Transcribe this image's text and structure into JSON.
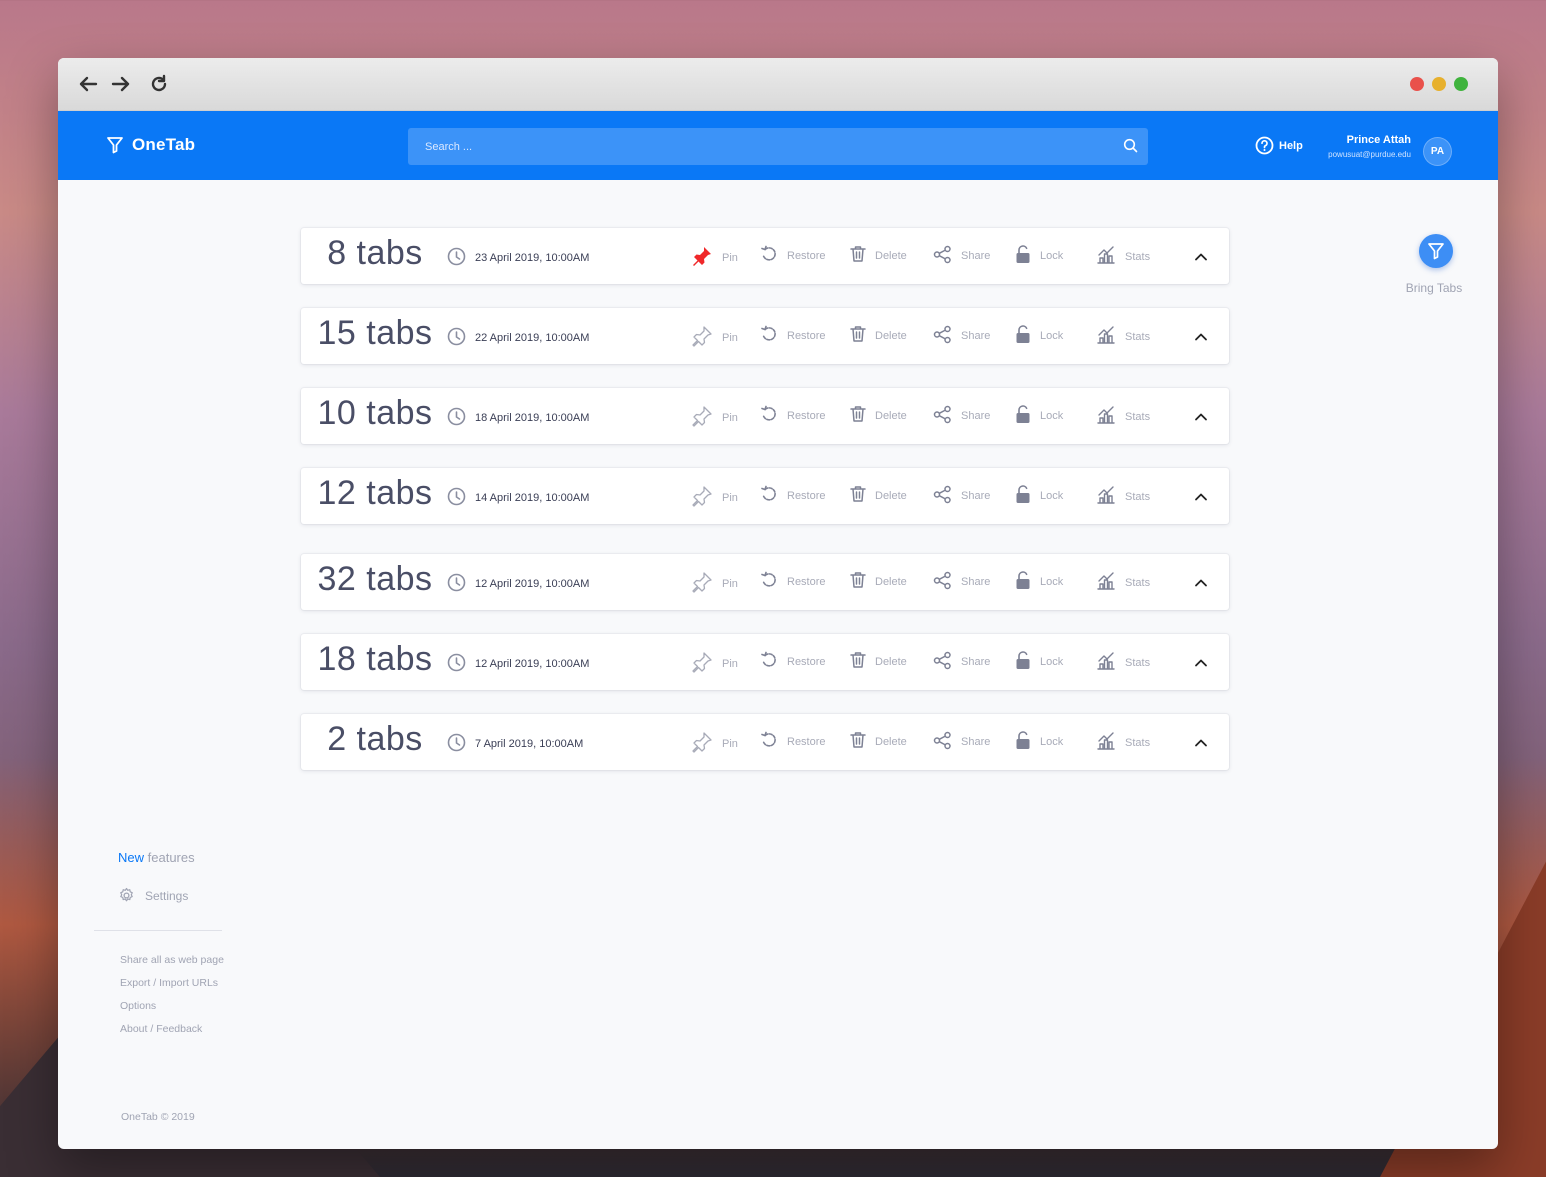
{
  "app": {
    "name": "OneTab",
    "footer": "OneTab © 2019"
  },
  "search": {
    "placeholder": "Search ..."
  },
  "header": {
    "help_label": "Help",
    "user_name": "Prince Attah",
    "user_email": "powusuat@purdue.edu",
    "avatar_initials": "PA"
  },
  "actions": {
    "pin": "Pin",
    "restore": "Restore",
    "delete": "Delete",
    "share": "Share",
    "lock": "Lock",
    "stats": "Stats"
  },
  "groups": [
    {
      "count": "8 tabs",
      "date": "23 April 2019, 10:00AM",
      "pinned": true
    },
    {
      "count": "15 tabs",
      "date": "22 April 2019, 10:00AM",
      "pinned": false
    },
    {
      "count": "10 tabs",
      "date": "18 April 2019, 10:00AM",
      "pinned": false
    },
    {
      "count": "12 tabs",
      "date": "14 April 2019, 10:00AM",
      "pinned": false
    },
    {
      "count": "32 tabs",
      "date": "12 April 2019, 10:00AM",
      "pinned": false
    },
    {
      "count": "18 tabs",
      "date": "12 April 2019, 10:00AM",
      "pinned": false
    },
    {
      "count": "2 tabs",
      "date": "7 April 2019, 10:00AM",
      "pinned": false
    }
  ],
  "bring_tabs": {
    "label": "Bring Tabs"
  },
  "sidebar": {
    "new_word": "New",
    "features_word": "features",
    "settings_label": "Settings",
    "links": [
      "Share all as web page",
      "Export / Import URLs",
      "Options",
      "About / Feedback"
    ]
  },
  "colors": {
    "accent": "#0a78f6",
    "pin_active": "#f0282a",
    "muted": "#a8abb8"
  }
}
